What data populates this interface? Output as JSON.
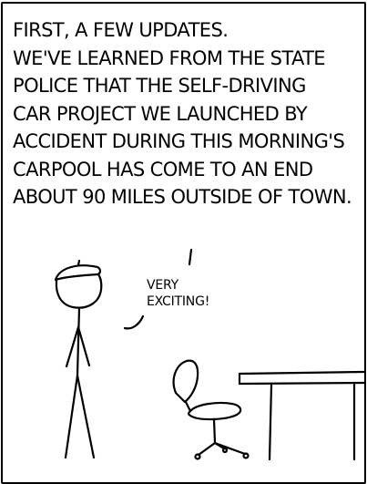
{
  "comic": {
    "caption_lines": [
      "FIRST, A FEW UPDATES.",
      "WE'VE LEARNED FROM THE STATE",
      "POLICE THAT THE SELF-DRIVING",
      "CAR PROJECT WE LAUNCHED BY",
      "ACCIDENT DURING THIS MORNING'S",
      "CARPOOL HAS COME TO AN END",
      "ABOUT 90 MILES OUTSIDE OF TOWN."
    ],
    "speech_lines": [
      "VERY",
      "EXCITING!"
    ]
  }
}
